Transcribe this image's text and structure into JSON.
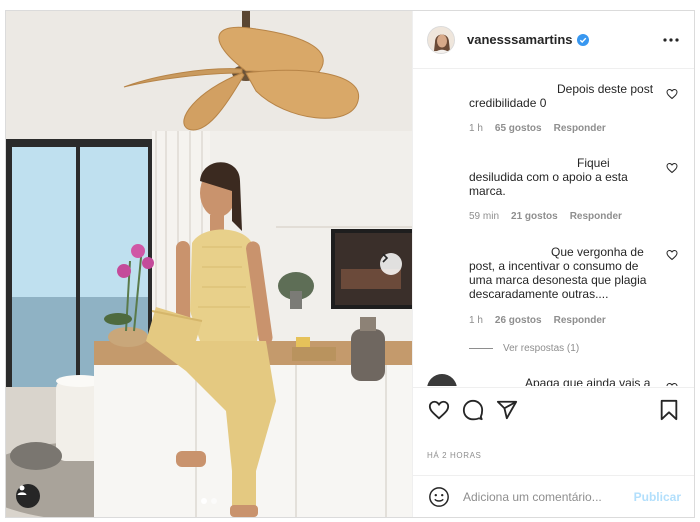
{
  "post": {
    "username": "vanesssamartins",
    "verified": true,
    "timestamp": "HÁ 2 HORAS",
    "carousel": {
      "count": 2,
      "active_index": 0
    }
  },
  "comments": [
    {
      "text": "Depois deste post credibilidade 0",
      "time": "1 h",
      "likes": "65 gostos",
      "reply_label": "Responder"
    },
    {
      "text": "Fiquei desiludida com o apoio a esta marca.",
      "time": "59 min",
      "likes": "21 gostos",
      "reply_label": "Responder"
    },
    {
      "text": "Que vergonha de post, a incentivar o consumo de uma marca desonesta que plagia descaradamente outras....",
      "time": "1 h",
      "likes": "26 gostos",
      "reply_label": "Responder",
      "view_replies": "Ver respostas (1)"
    },
    {
      "text": "Apaga que ainda vais a tempo"
    }
  ],
  "composer": {
    "placeholder": "Adiciona um comentário...",
    "publish_label": "Publicar"
  },
  "icons": {
    "more": "more-options-icon",
    "like": "heart-icon",
    "comment": "comment-bubble-icon",
    "share": "paper-plane-icon",
    "save": "bookmark-icon",
    "emoji": "emoji-face-icon",
    "next": "chevron-right-icon",
    "tag": "user-tag-icon"
  },
  "colors": {
    "verified_blue": "#3897f0",
    "text_primary": "#262626",
    "text_secondary": "#8e8e8e",
    "publish_disabled": "#b2dffc"
  }
}
